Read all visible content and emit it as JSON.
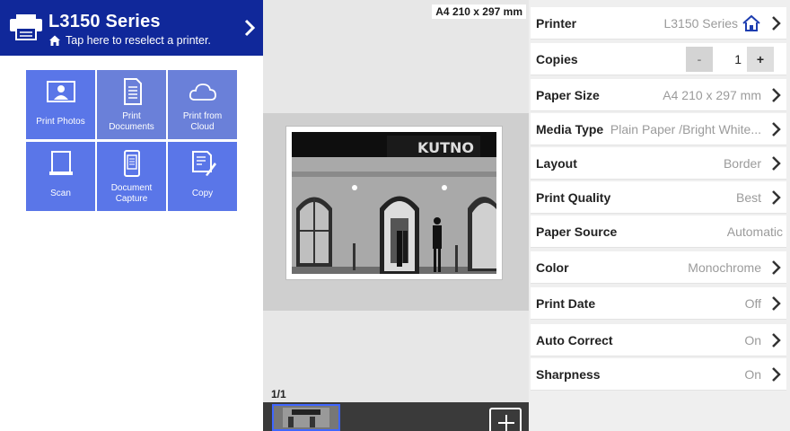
{
  "header": {
    "printer_name": "L3150 Series",
    "reselect_text": "Tap here to reselect a printer."
  },
  "tiles": [
    {
      "label": "Print Photos",
      "icon": "photo-icon"
    },
    {
      "label": "Print Documents",
      "icon": "document-icon"
    },
    {
      "label": "Print from Cloud",
      "icon": "cloud-icon"
    },
    {
      "label": "Scan",
      "icon": "scanner-icon"
    },
    {
      "label": "Document Capture",
      "icon": "phone-document-icon"
    },
    {
      "label": "Copy",
      "icon": "copy-icon"
    }
  ],
  "tile_label_lines": {
    "print_photos": "Print Photos",
    "print_documents_1": "Print",
    "print_documents_2": "Documents",
    "print_cloud_1": "Print from",
    "print_cloud_2": "Cloud",
    "scan": "Scan",
    "capture_1": "Document",
    "capture_2": "Capture",
    "copy": "Copy"
  },
  "preview": {
    "paper_size_label": "A4 210 x 297 mm",
    "page_counter": "1/1",
    "photo_sign_text": "KUTNO"
  },
  "settings": {
    "printer": {
      "label": "Printer",
      "value": "L3150 Series"
    },
    "copies": {
      "label": "Copies",
      "value": "1",
      "minus": "-",
      "plus": "+"
    },
    "paper_size": {
      "label": "Paper Size",
      "value": "A4 210 x 297 mm"
    },
    "media_type": {
      "label": "Media Type",
      "value": "Plain Paper /Bright White..."
    },
    "layout": {
      "label": "Layout",
      "value": "Border"
    },
    "print_quality": {
      "label": "Print Quality",
      "value": "Best"
    },
    "paper_source": {
      "label": "Paper Source",
      "value": "Automatic"
    },
    "color": {
      "label": "Color",
      "value": "Monochrome"
    },
    "print_date": {
      "label": "Print Date",
      "value": "Off"
    },
    "auto_correct": {
      "label": "Auto Correct",
      "value": "On"
    },
    "sharpness": {
      "label": "Sharpness",
      "value": "On"
    }
  },
  "colors": {
    "header_blue": "#10289a",
    "tile_blue": "#5a76e8",
    "thumb_border": "#3f66ff"
  }
}
